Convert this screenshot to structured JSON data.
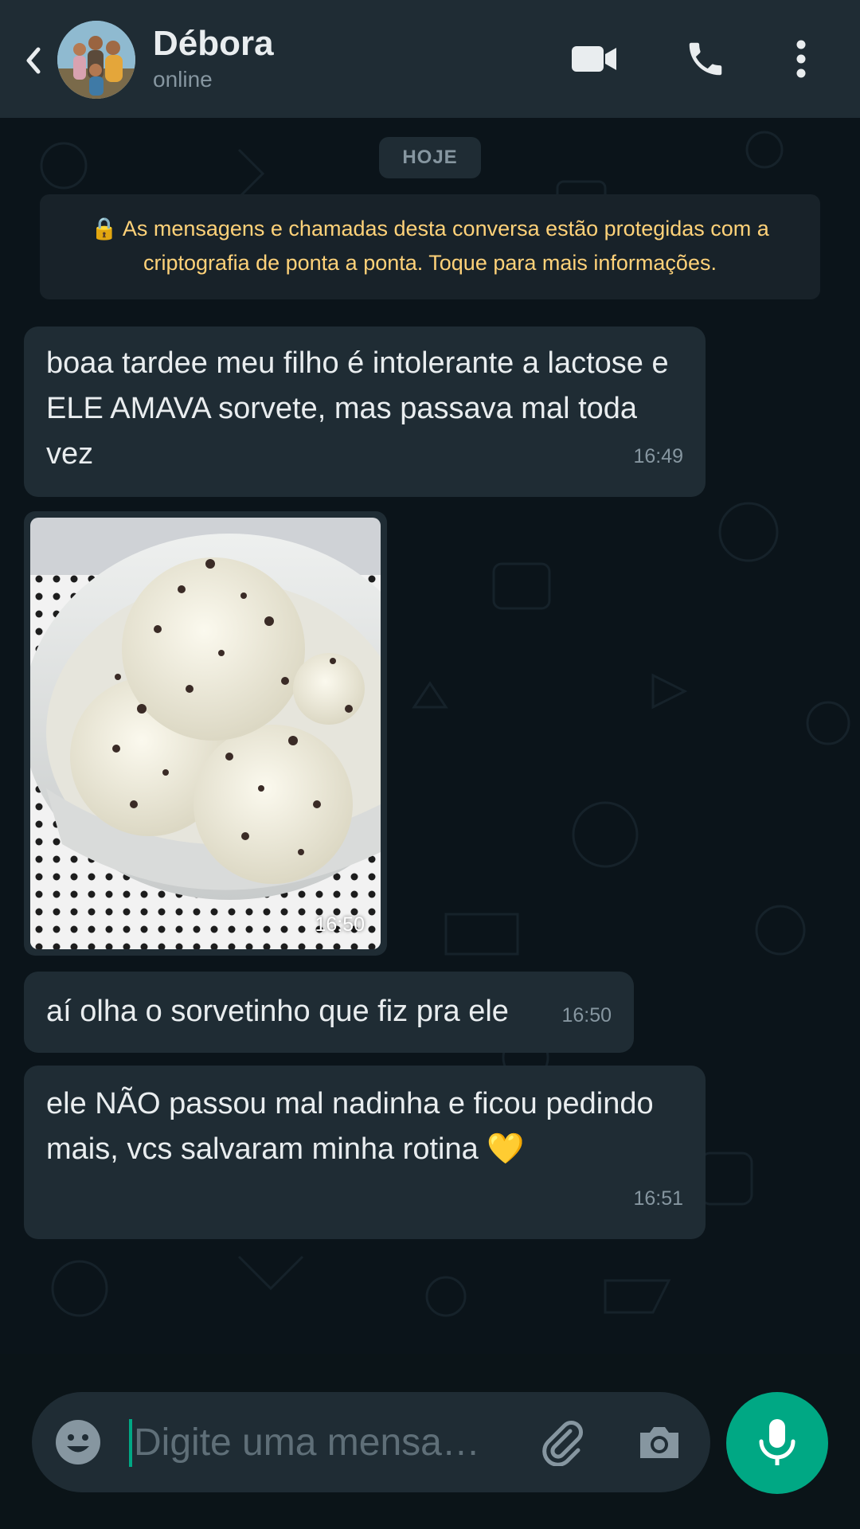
{
  "header": {
    "contact_name": "Débora",
    "status": "online",
    "icons": [
      "back-arrow-icon",
      "video-call-icon",
      "phone-call-icon",
      "more-options-icon"
    ]
  },
  "chat": {
    "date_chip": "HOJE",
    "encryption_notice": "🔒 As mensagens e chamadas desta conversa estão protegidas com a criptografia de ponta a ponta. Toque para mais informações.",
    "messages": [
      {
        "type": "text",
        "text": "boaa tardee meu filho é intolerante a lactose e ELE AMAVA sorvete, mas passava mal toda vez",
        "time": "16:49"
      },
      {
        "type": "image",
        "time": "16:50"
      },
      {
        "type": "text",
        "text": "aí olha o sorvetinho que fiz pra ele",
        "time": "16:50"
      },
      {
        "type": "text",
        "text": "ele NÃO passou mal nadinha e ficou pedindo mais, vcs salvaram minha rotina 💛",
        "time": "16:51"
      }
    ]
  },
  "composer": {
    "placeholder": "Digite uma mensa…",
    "icons": [
      "emoji-icon",
      "attach-clip-icon",
      "camera-icon",
      "microphone-icon"
    ]
  },
  "colors": {
    "header_bg": "#1f2c34",
    "chat_bg": "#0b141a",
    "bubble_bg": "#1f2c34",
    "notice_text": "#ffd279",
    "accent": "#00a884"
  }
}
